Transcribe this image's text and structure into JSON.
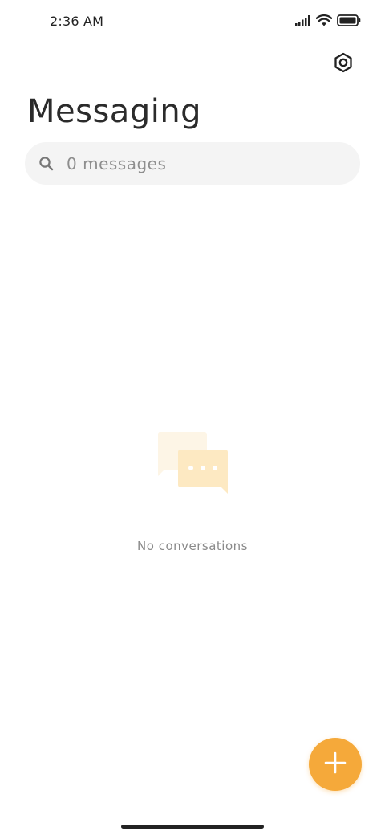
{
  "status_bar": {
    "time": "2:36 AM"
  },
  "header": {
    "title": "Messaging",
    "settings_icon": "settings-hexagon-icon"
  },
  "search": {
    "placeholder": "0 messages",
    "value": ""
  },
  "empty_state": {
    "illustration": "chat-bubbles-icon",
    "message": "No conversations"
  },
  "fab": {
    "icon": "plus-icon",
    "color": "#f5a93a"
  },
  "colors": {
    "accent": "#f5a93a",
    "illustration_light": "#fdf3df",
    "illustration_mid": "#fde8bd"
  }
}
